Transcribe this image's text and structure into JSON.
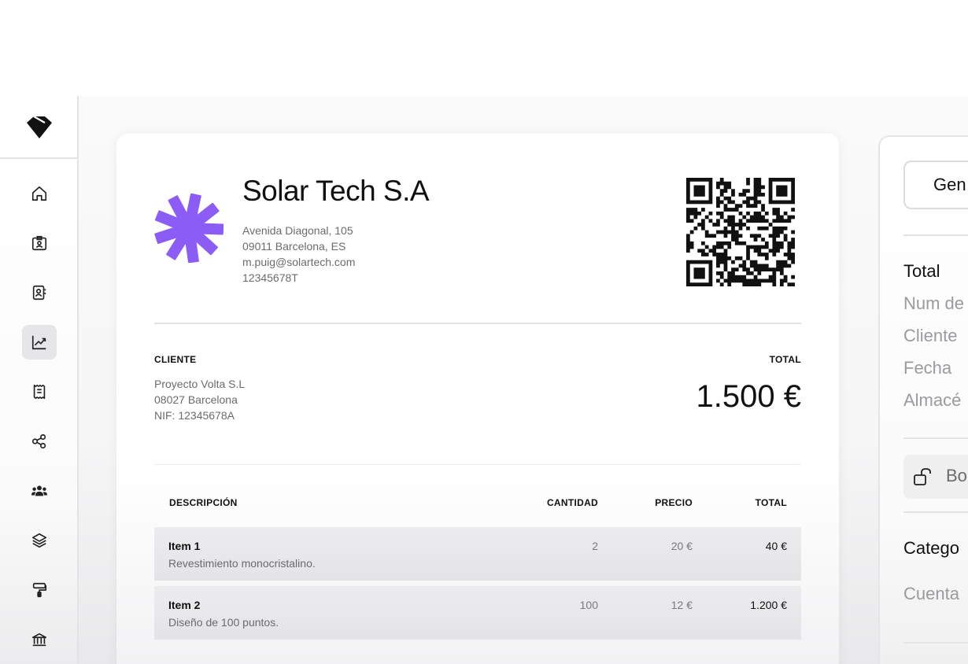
{
  "company": {
    "name": "Solar Tech S.A",
    "address_line1": "Avenida Diagonal, 105",
    "address_line2": "09011 Barcelona, ES",
    "email": "m.puig@solartech.com",
    "tax_id": "12345678T",
    "logo_color": "#8B5CF6"
  },
  "client": {
    "label": "CLIENTE",
    "name": "Proyecto Volta S.L",
    "city": "08027 Barcelona",
    "nif": "NIF: 12345678A"
  },
  "total": {
    "label": "TOTAL",
    "amount": "1.500 €"
  },
  "table": {
    "headers": {
      "description": "DESCRIPCIÓN",
      "quantity": "CANTIDAD",
      "price": "PRECIO",
      "total": "TOTAL"
    },
    "rows": [
      {
        "name": "Item 1",
        "description": "Revestimiento monocristalino.",
        "quantity": "2",
        "price": "20 €",
        "total": "40 €"
      },
      {
        "name": "Item 2",
        "description": "Diseño de 100 puntos.",
        "quantity": "100",
        "price": "12 €",
        "total": "1.200 €"
      }
    ]
  },
  "sidebar": {
    "items": [
      {
        "icon": "home-icon"
      },
      {
        "icon": "id-badge-icon"
      },
      {
        "icon": "contacts-book-icon"
      },
      {
        "icon": "trending-chart-icon",
        "active": true
      },
      {
        "icon": "receipt-icon"
      },
      {
        "icon": "share-nodes-icon"
      },
      {
        "icon": "users-group-icon"
      },
      {
        "icon": "layers-icon"
      },
      {
        "icon": "paint-roller-icon"
      },
      {
        "icon": "bank-icon"
      }
    ]
  },
  "panel": {
    "generate_button": "Gen",
    "total_label": "Total",
    "fields": [
      "Num de",
      "Cliente",
      "Fecha",
      "Almacé"
    ],
    "lock_label": "Bo",
    "category_label": "Catego",
    "account_label": "Cuenta"
  }
}
